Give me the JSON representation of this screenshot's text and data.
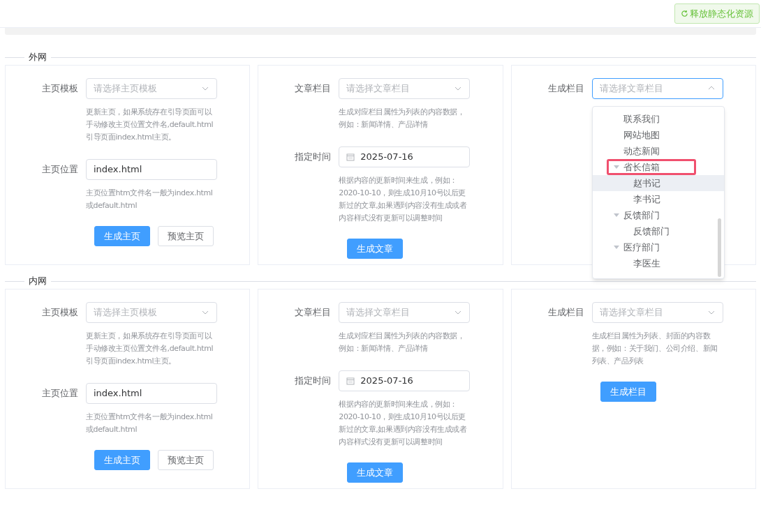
{
  "top_bar": {
    "button": "释放静态化资源"
  },
  "sections": [
    {
      "title": "外网",
      "cards": [
        {
          "fields": [
            {
              "kind": "select",
              "label": "主页模板",
              "placeholder": "请选择主页模板",
              "open": false,
              "hint": "更新主页，如果系统存在引导页面可以手动修改主页位置文件名,default.html引导页面index.html主页。"
            },
            {
              "kind": "input",
              "label": "主页位置",
              "value": "index.html",
              "hint": "主页位置htm文件名一般为index.html或default.html"
            }
          ],
          "buttons": [
            {
              "label": "生成主页",
              "kind": "primary"
            },
            {
              "label": "预览主页",
              "kind": "default"
            }
          ]
        },
        {
          "fields": [
            {
              "kind": "select",
              "label": "文章栏目",
              "placeholder": "请选择文章栏目",
              "open": false,
              "hint": "生成对应栏目属性为列表的内容数据，例如：新闻详情、产品详情"
            },
            {
              "kind": "date",
              "label": "指定时间",
              "value": "2025-07-16",
              "hint": "根据内容的更新时间来生成，例如：2020-10-10，则生成10月10号以后更新过的文章,如果遇到内容没有生成或者内容样式没有更新可以调整时间"
            }
          ],
          "buttons": [
            {
              "label": "生成文章",
              "kind": "primary"
            }
          ]
        },
        {
          "fields": [
            {
              "kind": "select",
              "label": "生成栏目",
              "placeholder": "请选择文章栏目",
              "open": true,
              "dropdown": [
                {
                  "label": "联系我们",
                  "highlighted": false,
                  "hovered": false
                },
                {
                  "label": "网站地图",
                  "highlighted": false,
                  "hovered": false
                },
                {
                  "label": "动态新闻",
                  "highlighted": false,
                  "hovered": false
                },
                {
                  "label": "省长信箱",
                  "highlighted": true,
                  "hovered": false,
                  "expanded": true,
                  "children": [
                    {
                      "label": "赵书记",
                      "highlighted": false,
                      "hovered": true
                    },
                    {
                      "label": "李书记",
                      "highlighted": false,
                      "hovered": false
                    }
                  ]
                },
                {
                  "label": "反馈部门",
                  "highlighted": false,
                  "hovered": false,
                  "expanded": true,
                  "children": [
                    {
                      "label": "反馈部门",
                      "highlighted": false,
                      "hovered": false
                    }
                  ]
                },
                {
                  "label": "医疗部门",
                  "highlighted": false,
                  "hovered": false,
                  "expanded": true,
                  "children": [
                    {
                      "label": "李医生",
                      "highlighted": false,
                      "hovered": false
                    }
                  ]
                }
              ]
            }
          ]
        }
      ]
    },
    {
      "title": "内网",
      "cards": [
        {
          "fields": [
            {
              "kind": "select",
              "label": "主页模板",
              "placeholder": "请选择主页模板",
              "open": false,
              "hint": "更新主页，如果系统存在引导页面可以手动修改主页位置文件名,default.html引导页面index.html主页。"
            },
            {
              "kind": "input",
              "label": "主页位置",
              "value": "index.html",
              "hint": "主页位置htm文件名一般为index.html或default.html"
            }
          ],
          "buttons": [
            {
              "label": "生成主页",
              "kind": "primary"
            },
            {
              "label": "预览主页",
              "kind": "default"
            }
          ]
        },
        {
          "fields": [
            {
              "kind": "select",
              "label": "文章栏目",
              "placeholder": "请选择文章栏目",
              "open": false,
              "hint": "生成对应栏目属性为列表的内容数据，例如：新闻详情、产品详情"
            },
            {
              "kind": "date",
              "label": "指定时间",
              "value": "2025-07-16",
              "hint": "根据内容的更新时间来生成，例如：2020-10-10，则生成10月10号以后更新过的文章,如果遇到内容没有生成或者内容样式没有更新可以调整时间"
            }
          ],
          "buttons": [
            {
              "label": "生成文章",
              "kind": "primary"
            }
          ]
        },
        {
          "fields": [
            {
              "kind": "select",
              "label": "生成栏目",
              "placeholder": "请选择文章栏目",
              "open": false,
              "hint": "生成栏目属性为列表、封面的内容数据，例如：关于我们、公司介绍、新闻列表、产品列表"
            }
          ],
          "buttons": [
            {
              "label": "生成栏目",
              "kind": "primary"
            }
          ]
        }
      ]
    }
  ]
}
